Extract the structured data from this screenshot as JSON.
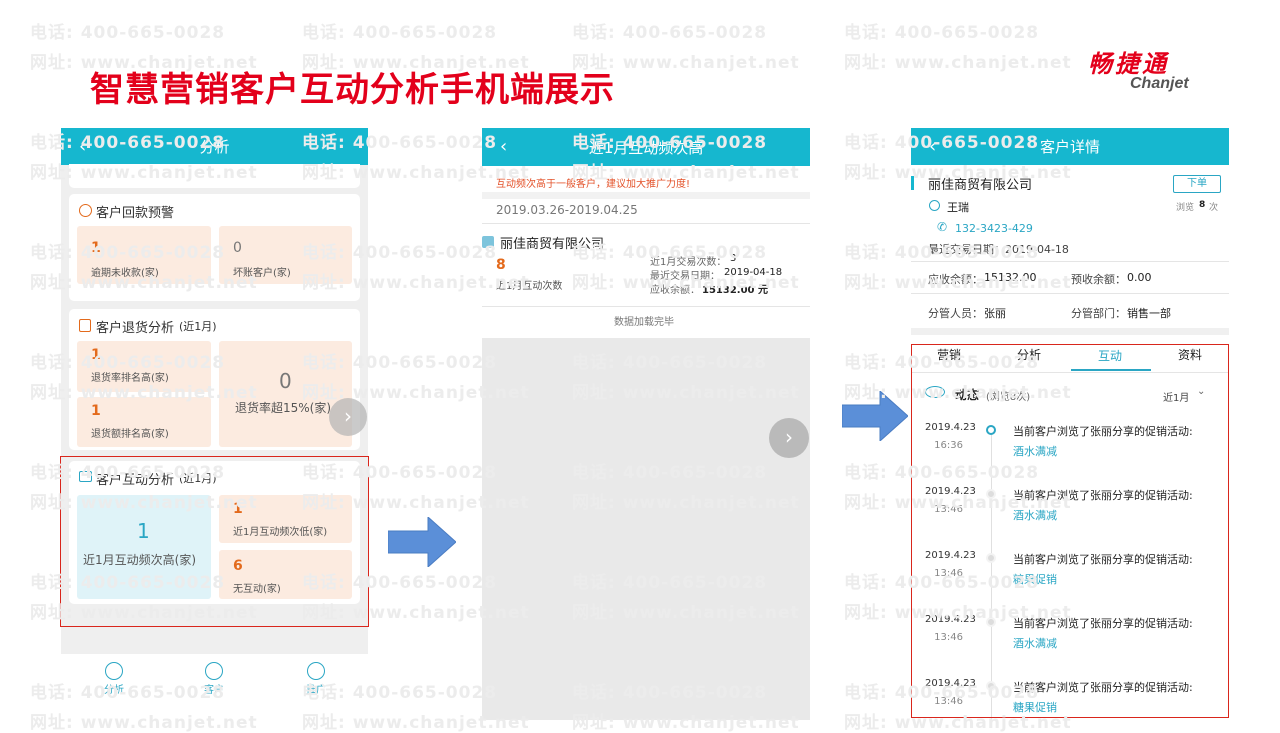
{
  "slide": {
    "title": "智慧营销客户互动分析手机端展示",
    "logo_cn": "畅捷通",
    "logo_en": "Chanjet",
    "watermark_phone": "电话: 400-665-0028",
    "watermark_web": "网址: www.chanjet.net"
  },
  "phone1": {
    "header": "分析",
    "refund": {
      "title": "客户回款预警",
      "overdue_value": "1",
      "overdue_label": "逾期未收款(家)",
      "bad_value": "0",
      "bad_label": "坏账客户(家)"
    },
    "returns": {
      "title": "客户退货分析",
      "period": "(近1月)",
      "rate_rank_value": "1",
      "rate_rank_label": "退货率排名高(家)",
      "amount_rank_value": "1",
      "amount_rank_label": "退货额排名高(家)",
      "over_value": "0",
      "over_label": "退货率超15%(家)"
    },
    "interaction": {
      "title": "客户互动分析",
      "period": "(近1月)",
      "high_value": "1",
      "high_label": "近1月互动频次高(家)",
      "low_value": "1",
      "low_label": "近1月互动频次低(家)",
      "none_value": "6",
      "none_label": "无互动(家)"
    },
    "nav": [
      "分析",
      "客户",
      "推广"
    ]
  },
  "phone2": {
    "header": "近1月互动频次高",
    "hint": "互动频次高于一般客户，建议加大推广力度!",
    "date_range": "2019.03.26-2019.04.25",
    "company": "丽佳商贸有限公司",
    "count_value": "8",
    "count_label": "近1月互动次数",
    "deals": "近1月交易次数：",
    "deals_value": "3",
    "last_date": "最近交易日期：",
    "last_date_value": "2019-04-18",
    "balance": "应收余额：",
    "balance_value": "15132.00 元",
    "footer": "数据加载完毕"
  },
  "phone3": {
    "header": "客户详情",
    "company": "丽佳商贸有限公司",
    "order_btn": "下单",
    "contact": "王瑞",
    "views": "浏览",
    "views_count": "8",
    "views_unit": "次",
    "phone": "132-3423-429",
    "last_deal": "最近交易日期：2019-04-18",
    "receivable_label": "应收余额：",
    "receivable_value": "15132.00",
    "prepaid_label": "预收余额：",
    "prepaid_value": "0.00",
    "manager_label": "分管人员：",
    "manager_value": "张丽",
    "dept_label": "分管部门：",
    "dept_value": "销售一部",
    "tabs": [
      "营销",
      "分析",
      "互动",
      "资料"
    ],
    "active_tab": "互动",
    "feed_title": "动态",
    "feed_count": "(浏览8次)",
    "period": "近1月",
    "events": [
      {
        "date": "2019.4.23",
        "time": "16:36",
        "text": "当前客户浏览了张丽分享的促销活动:",
        "link": "酒水满减"
      },
      {
        "date": "2019.4.23",
        "time": "13:46",
        "text": "当前客户浏览了张丽分享的促销活动:",
        "link": "酒水满减"
      },
      {
        "date": "2019.4.23",
        "time": "13:46",
        "text": "当前客户浏览了张丽分享的促销活动:",
        "link": "糖果促销"
      },
      {
        "date": "2019.4.23",
        "time": "13:46",
        "text": "当前客户浏览了张丽分享的促销活动:",
        "link": "酒水满减"
      },
      {
        "date": "2019.4.23",
        "time": "13:46",
        "text": "当前客户浏览了张丽分享的促销活动:",
        "link": "糖果促销"
      }
    ]
  }
}
